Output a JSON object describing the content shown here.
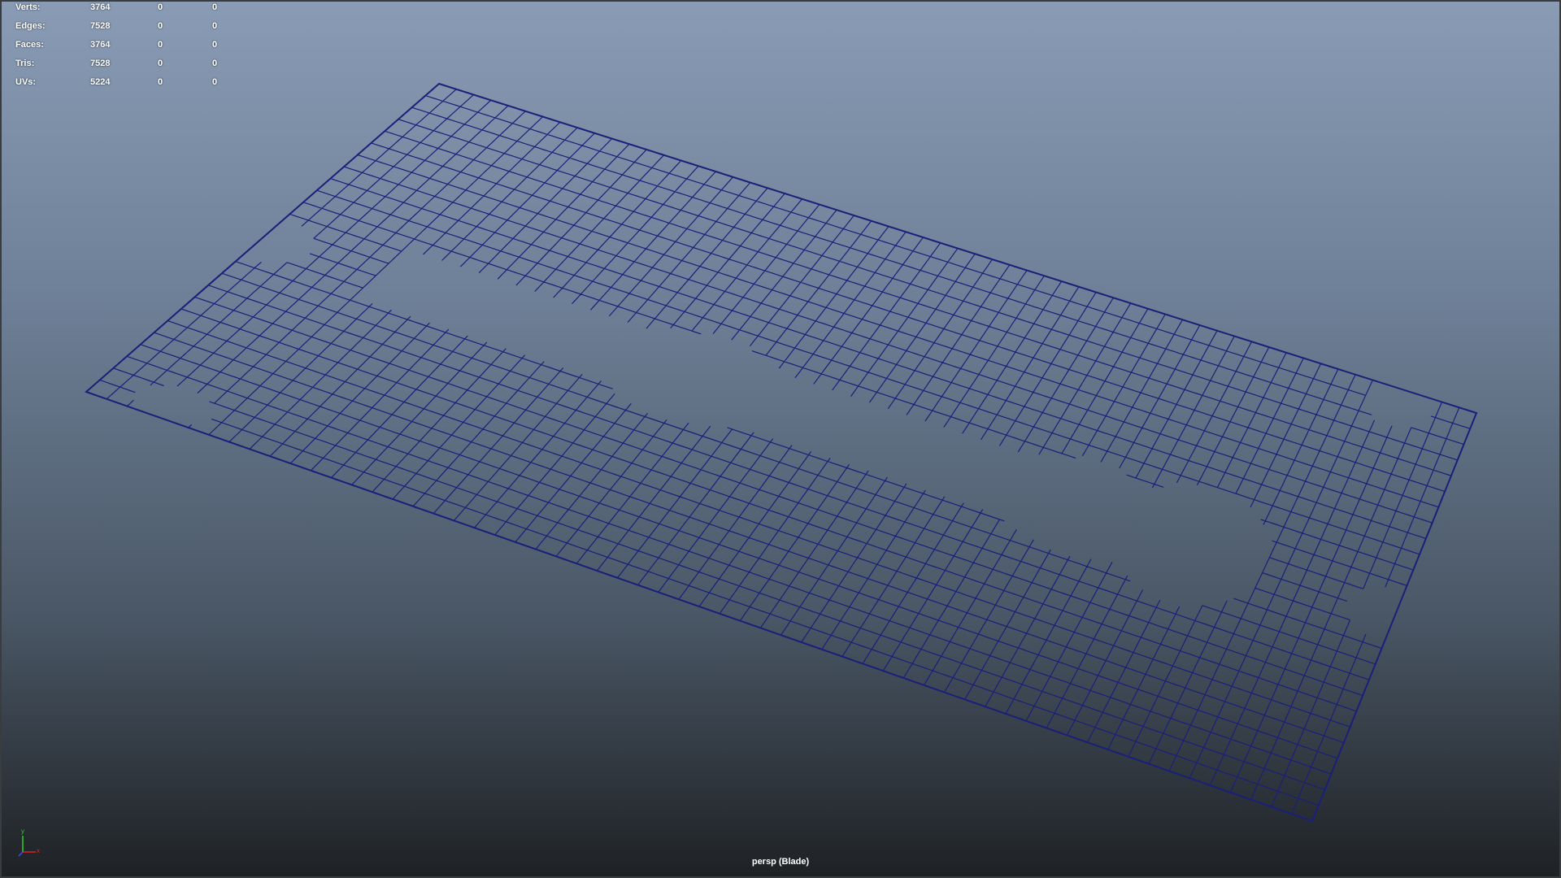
{
  "hud": {
    "rows": [
      {
        "label": "Verts:",
        "total": "3764",
        "selected": "0",
        "highlighted": "0"
      },
      {
        "label": "Edges:",
        "total": "7528",
        "selected": "0",
        "highlighted": "0"
      },
      {
        "label": "Faces:",
        "total": "3764",
        "selected": "0",
        "highlighted": "0"
      },
      {
        "label": "Tris:",
        "total": "7528",
        "selected": "0",
        "highlighted": "0"
      },
      {
        "label": "UVs:",
        "total": "5224",
        "selected": "0",
        "highlighted": "0"
      }
    ]
  },
  "viewport": {
    "camera_label": "persp (Blade)",
    "background_top": "#8a9cb5",
    "background_bottom": "#1e2124",
    "wireframe_color": "#1a1f7a"
  },
  "axis_gizmo": {
    "y_label": "y",
    "x_label": "x",
    "y_color": "#2fd12f",
    "x_color": "#e02020",
    "z_color": "#3050ff"
  }
}
